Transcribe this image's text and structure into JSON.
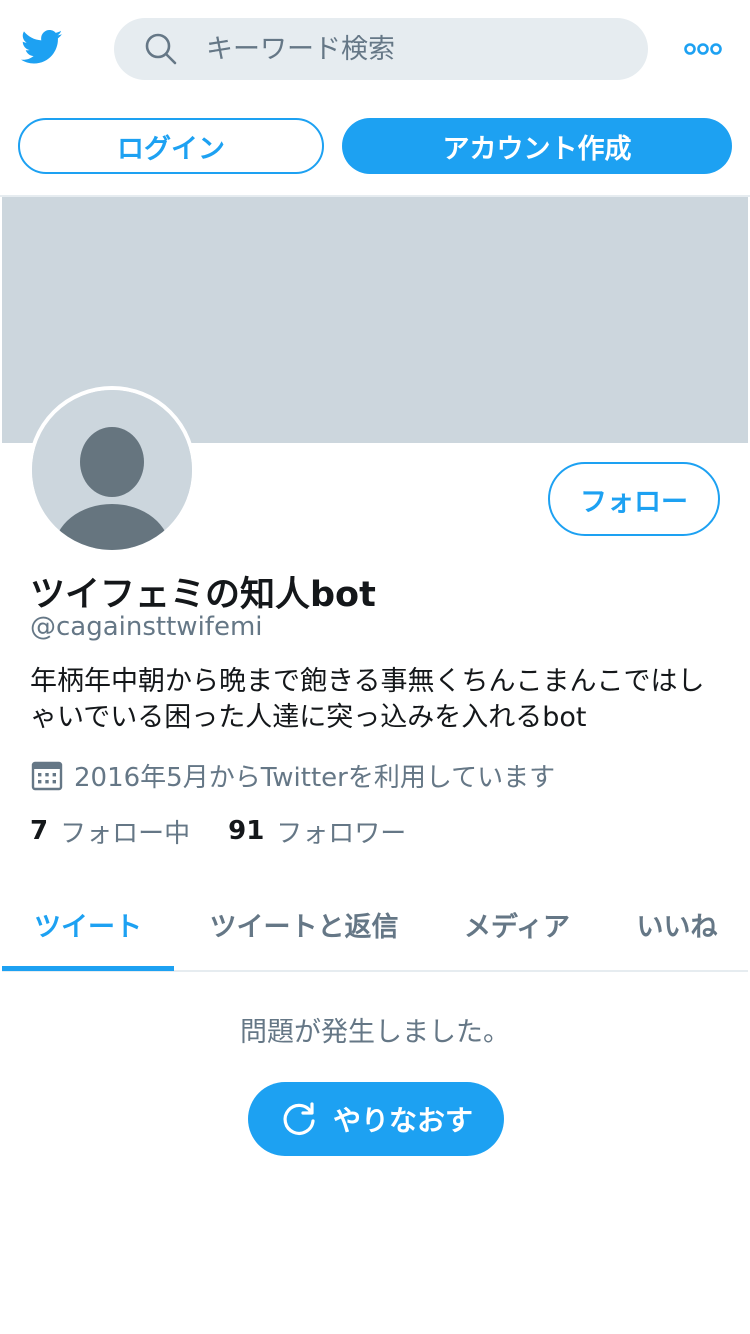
{
  "header": {
    "search_placeholder": "キーワード検索"
  },
  "auth": {
    "login_label": "ログイン",
    "signup_label": "アカウント作成"
  },
  "profile": {
    "follow_label": "フォロー",
    "display_name": "ツイフェミの知人bot",
    "handle": "@cagainsttwifemi",
    "bio": "年柄年中朝から晩まで飽きる事無くちんこまんこではしゃいでいる困った人達に突っ込みを入れるbot",
    "joined": "2016年5月からTwitterを利用しています",
    "following_count": "7",
    "following_label": "フォロー中",
    "followers_count": "91",
    "followers_label": "フォロワー"
  },
  "tabs": [
    {
      "label": "ツイート",
      "active": true
    },
    {
      "label": "ツイートと返信",
      "active": false
    },
    {
      "label": "メディア",
      "active": false
    },
    {
      "label": "いいね",
      "active": false
    }
  ],
  "timeline": {
    "error_message": "問題が発生しました。",
    "retry_label": "やりなおす"
  },
  "icons": {
    "logo": "twitter-bird-icon",
    "search": "search-icon",
    "more": "more-icon",
    "calendar": "calendar-icon",
    "retry": "refresh-icon"
  },
  "colors": {
    "accent": "#1da1f2",
    "banner": "#ccd6dd",
    "secondary_text": "#657786",
    "search_bg": "#e6ecf0"
  }
}
